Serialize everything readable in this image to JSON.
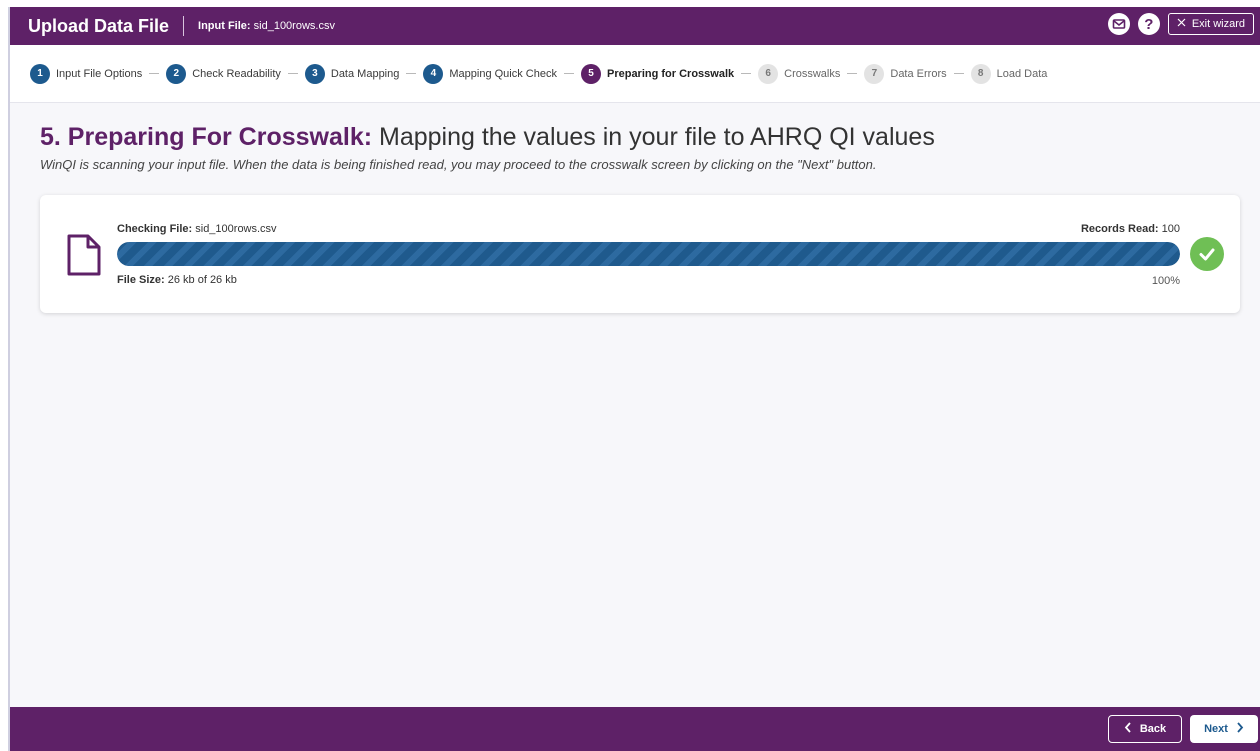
{
  "header": {
    "title": "Upload Data File",
    "input_file_label": "Input File:",
    "input_file_value": "sid_100rows.csv",
    "help_label": "?",
    "exit_label": "Exit wizard"
  },
  "steps": [
    {
      "num": "1",
      "label": "Input File Options",
      "state": "done"
    },
    {
      "num": "2",
      "label": "Check Readability",
      "state": "done"
    },
    {
      "num": "3",
      "label": "Data Mapping",
      "state": "done"
    },
    {
      "num": "4",
      "label": "Mapping Quick Check",
      "state": "done"
    },
    {
      "num": "5",
      "label": "Preparing for Crosswalk",
      "state": "active"
    },
    {
      "num": "6",
      "label": "Crosswalks",
      "state": "pending"
    },
    {
      "num": "7",
      "label": "Data Errors",
      "state": "pending"
    },
    {
      "num": "8",
      "label": "Load Data",
      "state": "pending"
    }
  ],
  "main": {
    "heading_strong": "5. Preparing For Crosswalk:",
    "heading_rest": " Mapping the values in your file to AHRQ QI values",
    "subtext": "WinQI is scanning your input file. When the data is being finished read, you may proceed to the crosswalk screen by clicking on the \"Next\" button."
  },
  "progress": {
    "checking_label": "Checking File:",
    "checking_value": " sid_100rows.csv",
    "records_label": "Records Read:",
    "records_value": " 100",
    "filesize_label": "File Size:",
    "filesize_value": " 26 kb of 26 kb",
    "percent_text": "100%",
    "percent_value": 100,
    "status": "complete"
  },
  "footer": {
    "back_label": "Back",
    "next_label": "Next"
  },
  "colors": {
    "brand": "#5e2167",
    "step_done": "#1d5a8e",
    "progress": "#1f5a8d",
    "success": "#6fbf55"
  },
  "icons": [
    "mail-icon",
    "help-icon",
    "close-icon",
    "file-icon",
    "check-circle-icon",
    "chevron-left-icon",
    "chevron-right-icon"
  ]
}
